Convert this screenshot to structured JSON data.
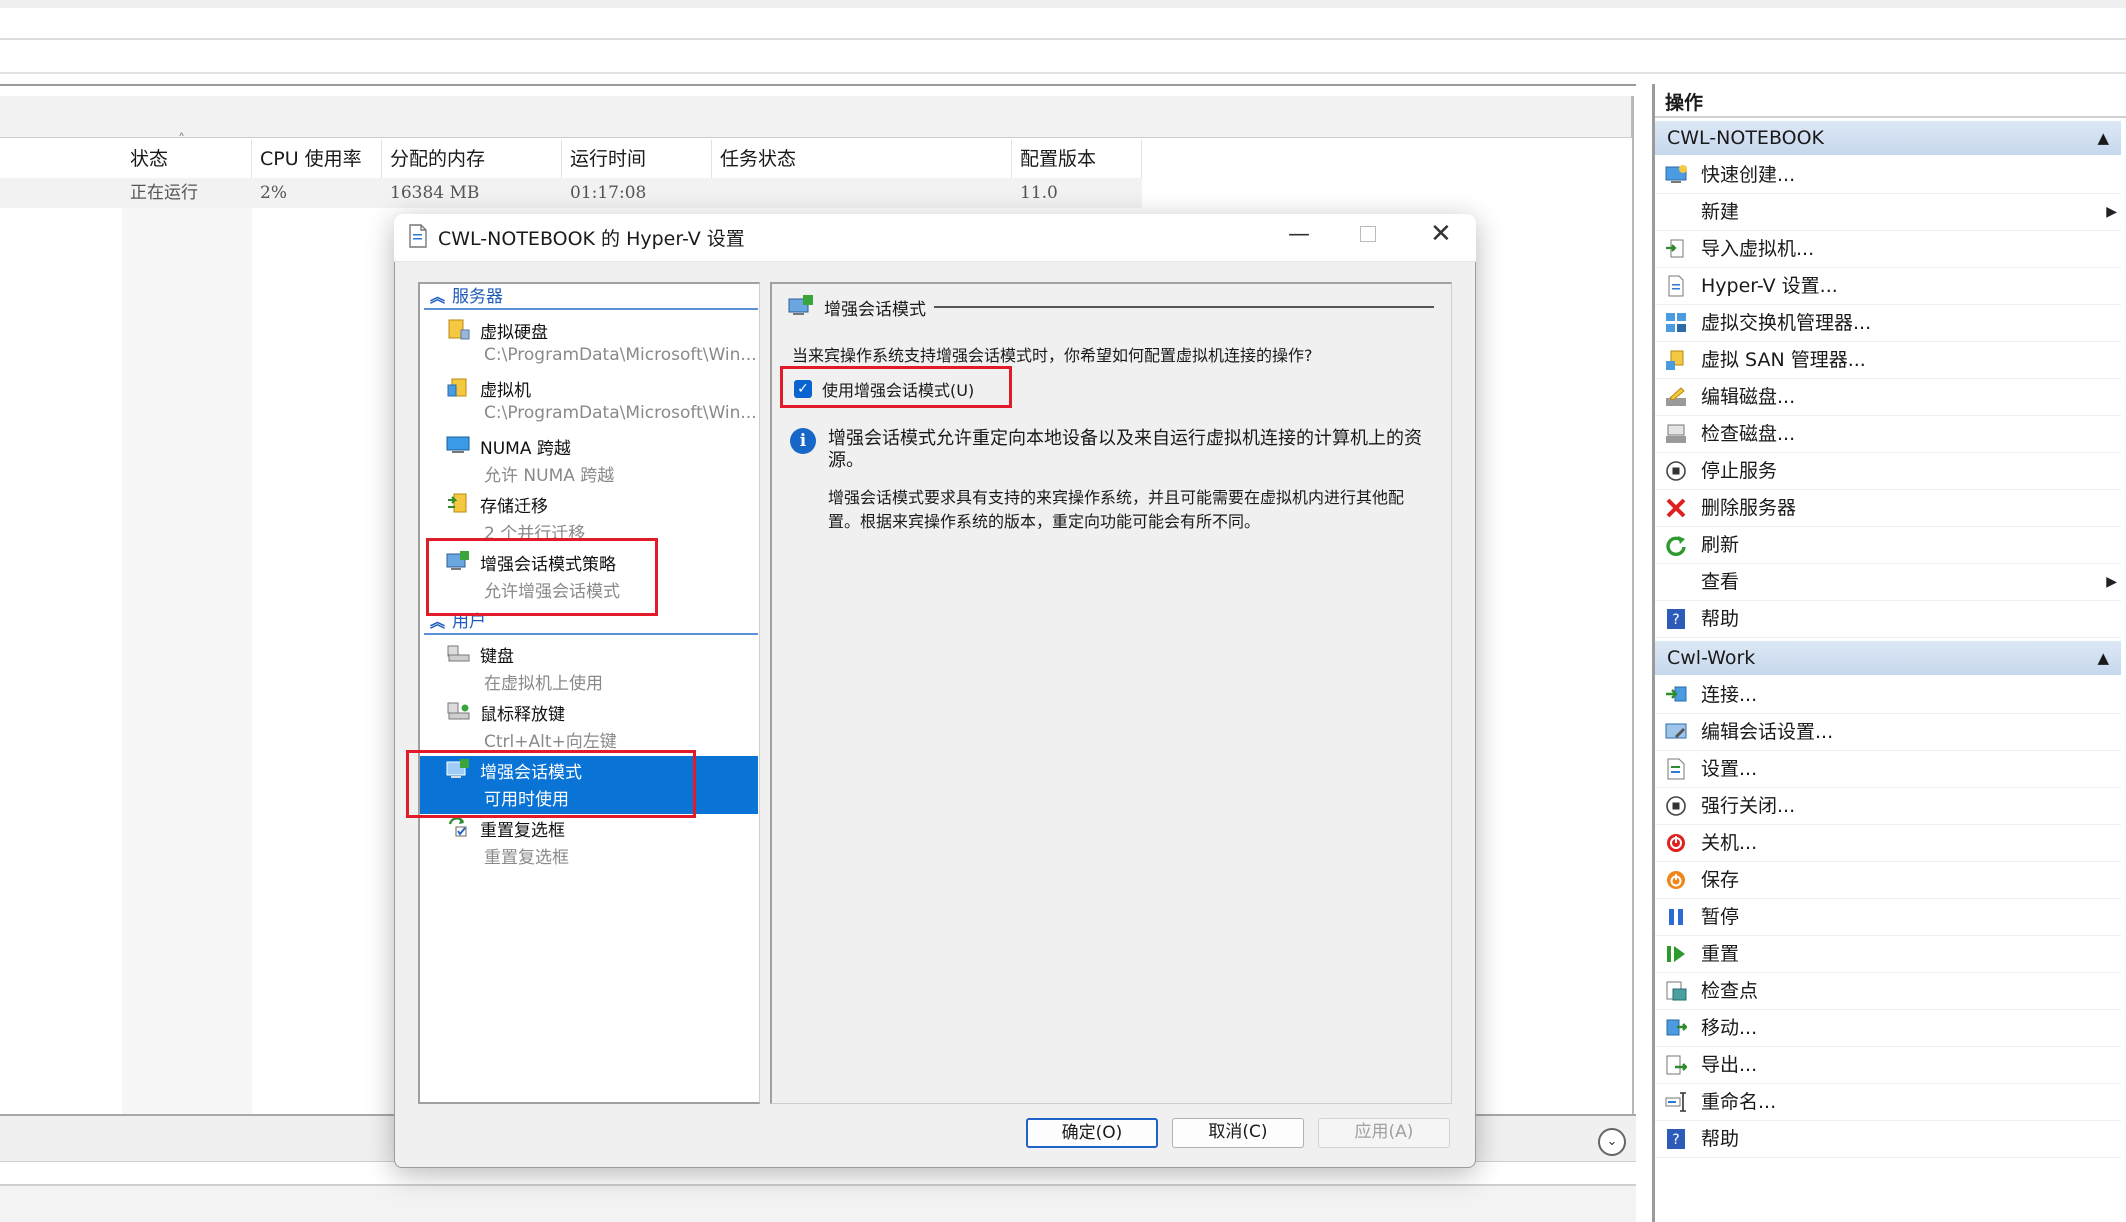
{
  "columns": [
    "状态",
    "CPU 使用率",
    "分配的内存",
    "运行时间",
    "任务状态",
    "配置版本"
  ],
  "vm_row": {
    "status": "正在运行",
    "cpu": "2%",
    "memory": "16384 MB",
    "uptime": "01:17:08",
    "task": "",
    "config_version": "11.0"
  },
  "dialog": {
    "title": "CWL-NOTEBOOK 的 Hyper-V 设置",
    "tree": {
      "server_section": "服务器",
      "user_section": "用户",
      "server_items": [
        {
          "title": "虚拟硬盘",
          "sub": "C:\\ProgramData\\Microsoft\\Win..."
        },
        {
          "title": "虚拟机",
          "sub": "C:\\ProgramData\\Microsoft\\Win..."
        },
        {
          "title": "NUMA 跨越",
          "sub": "允许 NUMA 跨越"
        },
        {
          "title": "存储迁移",
          "sub": "2 个并行迁移"
        },
        {
          "title": "增强会话模式策略",
          "sub": "允许增强会话模式"
        }
      ],
      "user_items": [
        {
          "title": "键盘",
          "sub": "在虚拟机上使用"
        },
        {
          "title": "鼠标释放键",
          "sub": "Ctrl+Alt+向左键"
        },
        {
          "title": "增强会话模式",
          "sub": "可用时使用"
        },
        {
          "title": "重置复选框",
          "sub": "重置复选框"
        }
      ]
    },
    "detail": {
      "heading": "增强会话模式",
      "question": "当来宾操作系统支持增强会话模式时，你希望如何配置虚拟机连接的操作?",
      "checkbox_label": "使用增强会话模式(U)",
      "checkbox_checked": true,
      "info_text": "增强会话模式允许重定向本地设备以及来自运行虚拟机连接的计算机上的资源。",
      "info_detail": "增强会话模式要求具有支持的来宾操作系统，并且可能需要在虚拟机内进行其他配置。根据来宾操作系统的版本，重定向功能可能会有所不同。"
    },
    "buttons": {
      "ok": "确定(O)",
      "cancel": "取消(C)",
      "apply": "应用(A)"
    }
  },
  "actions": {
    "title": "操作",
    "host_section": "CWL-NOTEBOOK",
    "host_items": [
      {
        "label": "快速创建...",
        "icon": "quick-create-icon"
      },
      {
        "label": "新建",
        "icon": "",
        "submenu": true
      },
      {
        "label": "导入虚拟机...",
        "icon": "import-vm-icon"
      },
      {
        "label": "Hyper-V 设置...",
        "icon": "hyperv-settings-icon"
      },
      {
        "label": "虚拟交换机管理器...",
        "icon": "virtual-switch-icon"
      },
      {
        "label": "虚拟 SAN 管理器...",
        "icon": "virtual-san-icon"
      },
      {
        "label": "编辑磁盘...",
        "icon": "edit-disk-icon"
      },
      {
        "label": "检查磁盘...",
        "icon": "inspect-disk-icon"
      },
      {
        "label": "停止服务",
        "icon": "stop-service-icon"
      },
      {
        "label": "删除服务器",
        "icon": "delete-server-icon"
      },
      {
        "label": "刷新",
        "icon": "refresh-icon"
      },
      {
        "label": "查看",
        "icon": "",
        "submenu": true
      },
      {
        "label": "帮助",
        "icon": "help-icon"
      }
    ],
    "vm_section": "Cwl-Work",
    "vm_items": [
      {
        "label": "连接...",
        "icon": "connect-icon"
      },
      {
        "label": "编辑会话设置...",
        "icon": "edit-session-icon"
      },
      {
        "label": "设置...",
        "icon": "settings-icon"
      },
      {
        "label": "强行关闭...",
        "icon": "turn-off-icon"
      },
      {
        "label": "关机...",
        "icon": "shutdown-icon"
      },
      {
        "label": "保存",
        "icon": "save-icon"
      },
      {
        "label": "暂停",
        "icon": "pause-icon"
      },
      {
        "label": "重置",
        "icon": "reset-icon"
      },
      {
        "label": "检查点",
        "icon": "checkpoint-icon"
      },
      {
        "label": "移动...",
        "icon": "move-icon"
      },
      {
        "label": "导出...",
        "icon": "export-icon"
      },
      {
        "label": "重命名...",
        "icon": "rename-icon"
      },
      {
        "label": "帮助",
        "icon": "help-icon"
      }
    ]
  },
  "colors": {
    "selection": "#0a74d6",
    "highlight_box": "#e21b2b",
    "section_link": "#1e5bbb"
  }
}
